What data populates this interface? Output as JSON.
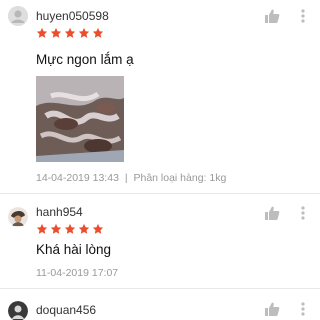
{
  "reviews": [
    {
      "username": "huyen050598",
      "rating": 5,
      "comment": "Mực ngon lắm ạ",
      "date": "14-04-2019 13:43",
      "separator": "|",
      "variation": "Phân loại hàng: 1kg",
      "avatar_icon": "default-user-icon",
      "has_photo": true
    },
    {
      "username": "hanh954",
      "rating": 5,
      "comment": "Khá hài lòng",
      "date": "11-04-2019 17:07",
      "avatar_icon": "user-photo-avatar"
    },
    {
      "username": "doquan456",
      "avatar_icon": "user-photo-avatar"
    }
  ],
  "colors": {
    "star": "#ee4d2d",
    "icon": "#bdbdbd",
    "meta_text": "#999999",
    "divider": "#e8e8e8"
  }
}
